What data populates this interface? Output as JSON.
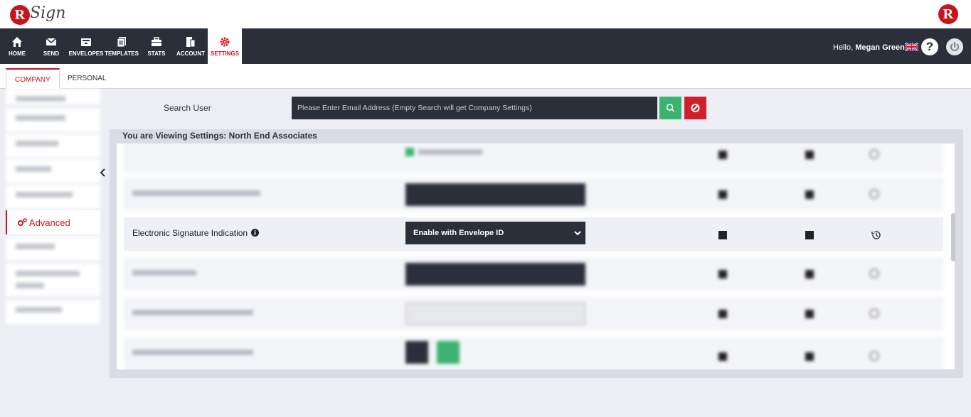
{
  "brand": {
    "logo_letter": "R",
    "logo_script": "Sign"
  },
  "nav": {
    "items": [
      {
        "label": "HOME",
        "icon": "home-icon"
      },
      {
        "label": "SEND",
        "icon": "envelope-icon"
      },
      {
        "label": "ENVELOPES",
        "icon": "inbox-icon"
      },
      {
        "label": "TEMPLATES",
        "icon": "template-icon"
      },
      {
        "label": "STATS",
        "icon": "briefcase-icon"
      },
      {
        "label": "ACCOUNT",
        "icon": "account-icon"
      },
      {
        "label": "SETTINGS",
        "icon": "gear-icon"
      }
    ],
    "active": "SETTINGS",
    "greeting_prefix": "Hello,",
    "user_name": "Megan Greene",
    "help_label": "?"
  },
  "tabs": [
    {
      "label": "COMPANY"
    },
    {
      "label": "PERSONAL"
    }
  ],
  "sidebar": {
    "items": [
      "Advanced"
    ],
    "active": "Advanced"
  },
  "search": {
    "label": "Search User",
    "placeholder": "Please Enter Email Address (Empty Search will get Company Settings)",
    "value": ""
  },
  "panel": {
    "title": "You are Viewing Settings: North End Associates",
    "rows": [
      {
        "label": "Electronic Signature Indication",
        "select_value": "Enable with Envelope ID"
      }
    ]
  },
  "colors": {
    "brand_red": "#c8141c",
    "nav_dark": "#2b2f3a",
    "search_green": "#3cb371",
    "clear_red": "#d2202a"
  }
}
